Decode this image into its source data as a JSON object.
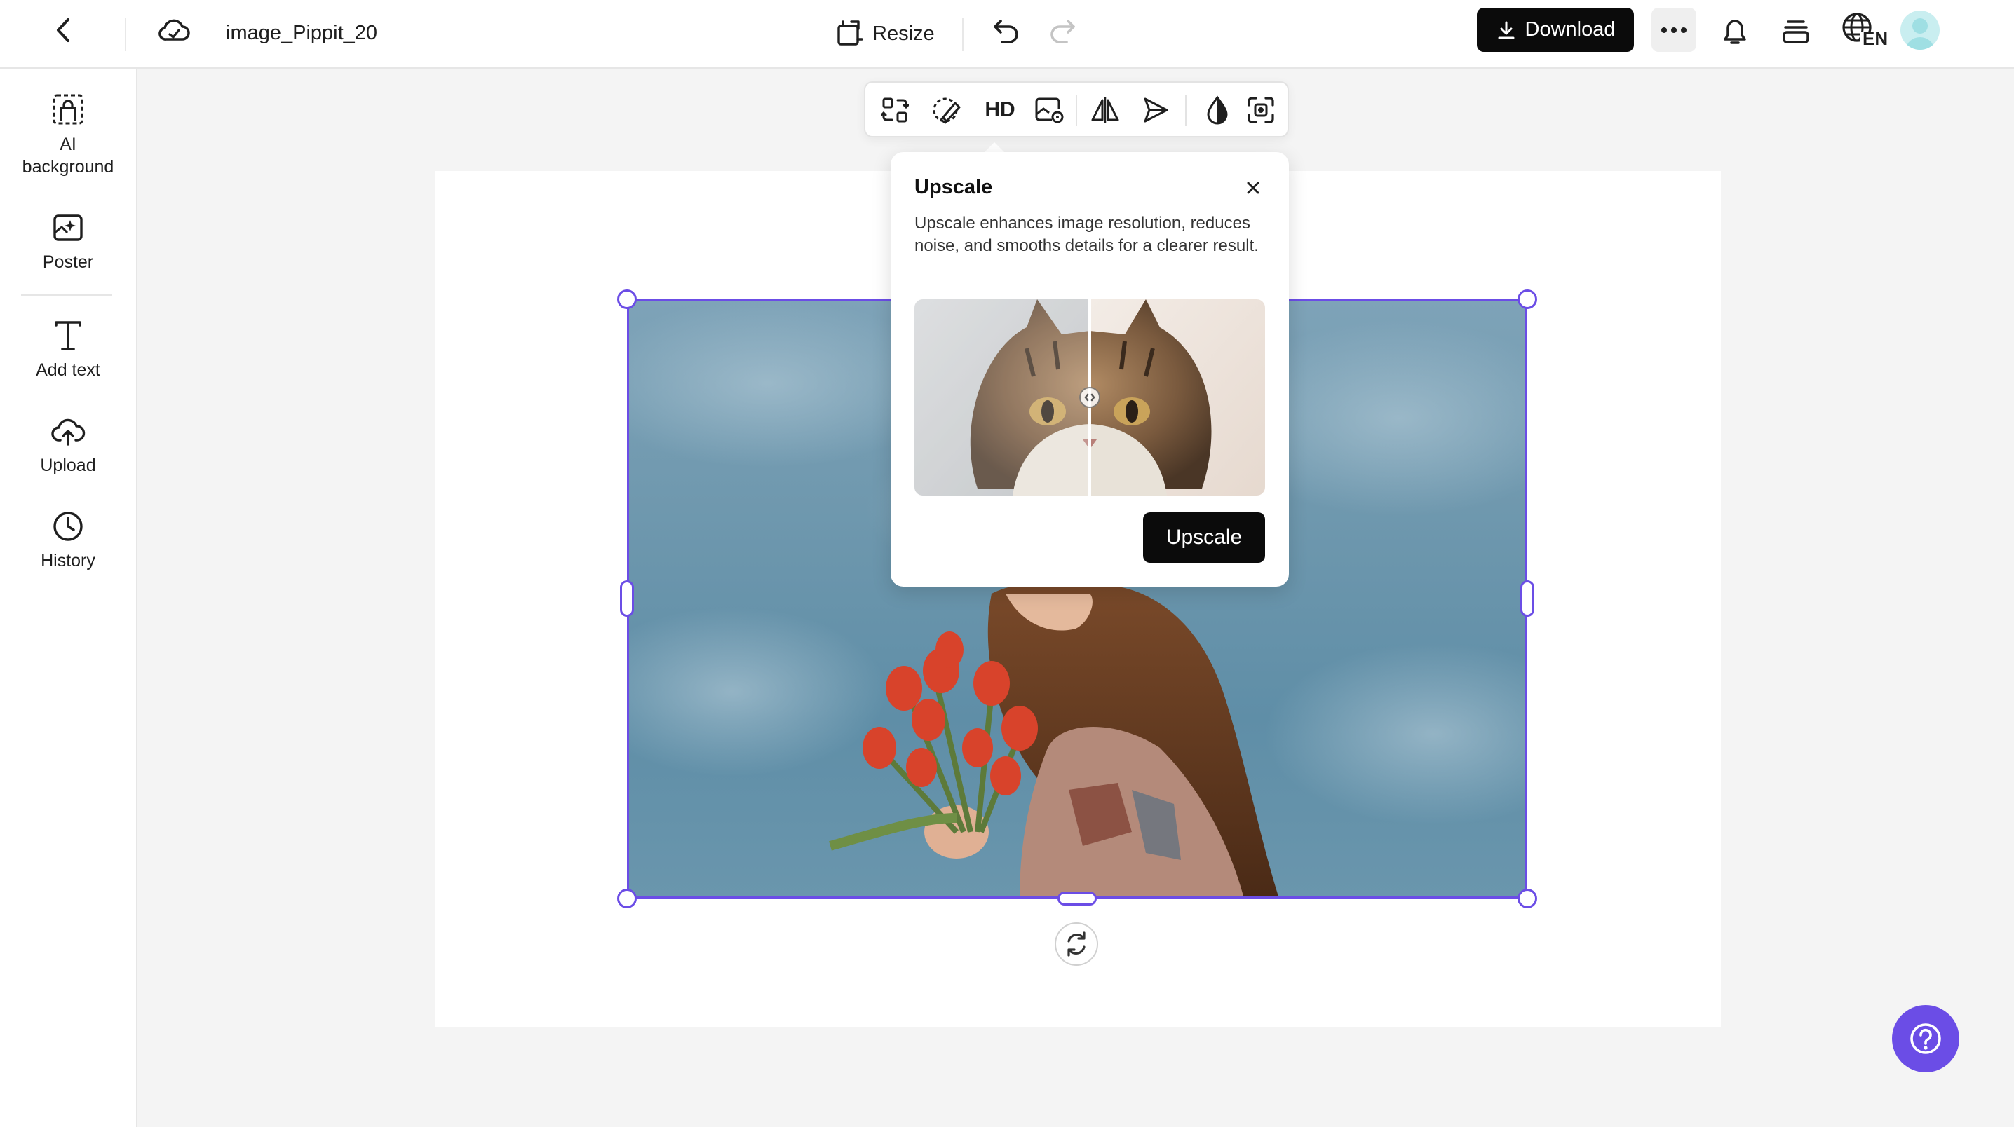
{
  "header": {
    "file_name": "image_Pippit_20",
    "resize_label": "Resize",
    "download_label": "Download",
    "language_code": "EN"
  },
  "sidebar": {
    "items": [
      {
        "label": "AI background",
        "icon": "ai-background-icon"
      },
      {
        "label": "Poster",
        "icon": "poster-icon"
      },
      {
        "label": "Add text",
        "icon": "text-icon"
      },
      {
        "label": "Upload",
        "icon": "upload-icon"
      },
      {
        "label": "History",
        "icon": "history-icon"
      }
    ]
  },
  "toolbar": {
    "hd_label": "HD",
    "tools": [
      "replace-icon",
      "magic-eraser-icon",
      "hd-icon",
      "image-edit-icon",
      "flip-icon",
      "send-icon",
      "opacity-icon",
      "focus-icon"
    ]
  },
  "popover": {
    "title": "Upscale",
    "description": "Upscale enhances image resolution, reduces noise, and smooths details for a clearer result.",
    "button_label": "Upscale"
  },
  "colors": {
    "accent": "#6b4de6",
    "dark_button": "#0b0b0b",
    "canvas_bg": "#f4f4f4"
  }
}
